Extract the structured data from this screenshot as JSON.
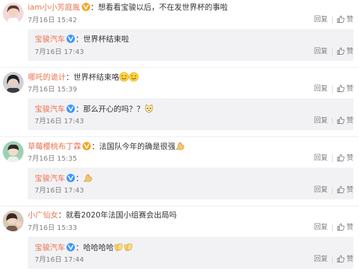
{
  "labels": {
    "reply": "回复",
    "like": "赞"
  },
  "colors": {
    "username": "#eb7350",
    "meta": "#808080",
    "reply_bg": "#f2f2f5",
    "vbadge": "#f5a623",
    "vbadge_blue": "#3a96ff"
  },
  "comments": [
    {
      "user": "iam小小芳庭胤",
      "badge": "vip-yellow-v",
      "text": "想看看宝骏以后，不在发世界杯的事啦",
      "time": "7月16日 15:42",
      "avatar": "avatar-girl-pink",
      "reply": {
        "user": "宝骏汽车",
        "badge": "verified-blue-v",
        "text": "世界杯结束啦",
        "time": "7月16日 17:43"
      }
    },
    {
      "user": "哪吒的诡计",
      "badge": "",
      "text": "世界杯结束咯",
      "emojis": [
        "smile-emoji",
        "smile-emoji"
      ],
      "time": "7月16日 15:39",
      "avatar": "avatar-girl-dark",
      "reply": {
        "user": "宝骏汽车",
        "badge": "verified-blue-v",
        "text": "那么开心的吗？？",
        "emojis": [
          "cat-emoji"
        ],
        "time": "7月16日 17:43"
      }
    },
    {
      "user": "草莓樱桃布丁霖",
      "badge": "vip-yellow-v",
      "text": "法国队今年的确是很强",
      "emojis": [
        "strong-arm-emoji"
      ],
      "time": "7月16日 15:35",
      "avatar": "avatar-green",
      "reply": {
        "user": "宝骏汽车",
        "badge": "verified-blue-v",
        "text": "",
        "emojis": [
          "strong-arm-emoji"
        ],
        "time": "7月16日 17:43"
      }
    },
    {
      "user": "小广仙女",
      "badge": "",
      "text": "就看2020年法国小组赛会出局吗",
      "time": "7月16日 15:33",
      "avatar": "avatar-girl-hand",
      "reply": {
        "user": "宝骏汽车",
        "badge": "verified-blue-v",
        "text": "哈哈哈哈",
        "emojis": [
          "clap-emoji",
          "clap-emoji"
        ],
        "time": "7月16日 17:44"
      }
    }
  ]
}
